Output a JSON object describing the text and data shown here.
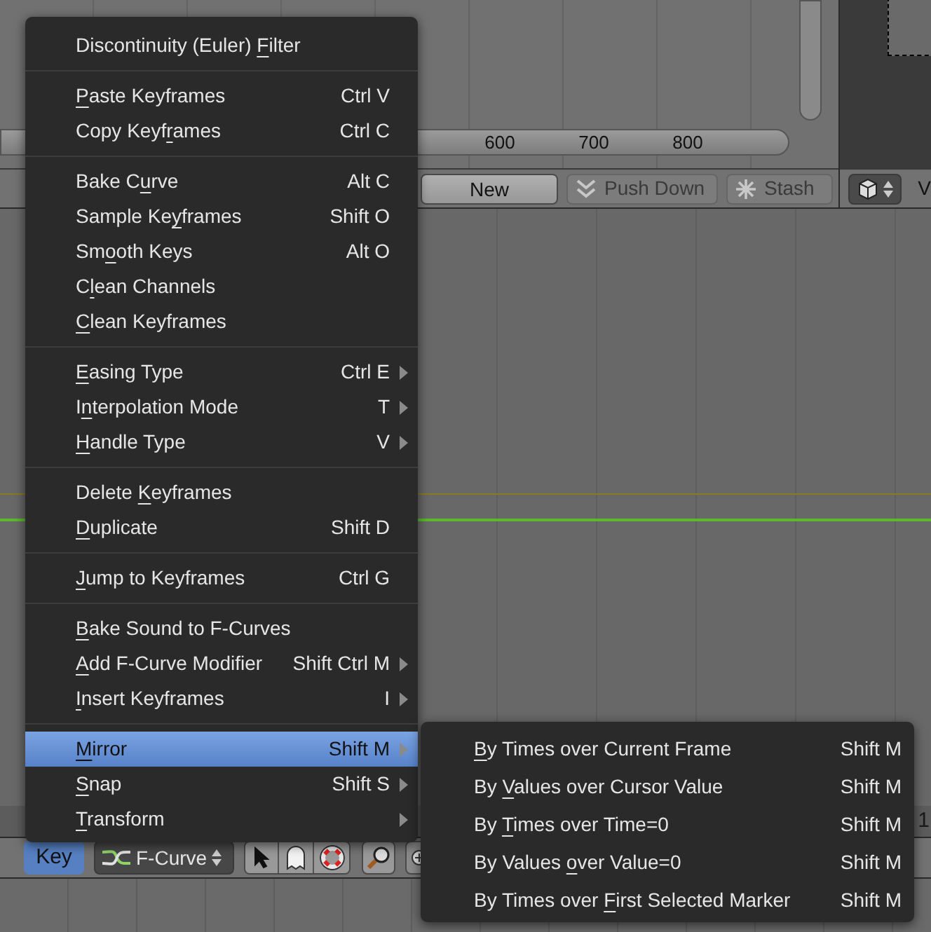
{
  "top_ruler": [
    "600",
    "700",
    "800"
  ],
  "top_header": {
    "buttons": [
      {
        "kind": "plain",
        "label": "New"
      },
      {
        "kind": "push",
        "label": "Push Down"
      },
      {
        "kind": "stash",
        "label": "Stash"
      }
    ]
  },
  "side_header": {
    "label": "V"
  },
  "bottom_ruler": [
    "1"
  ],
  "bottom_header": {
    "mode_button": {
      "label": "Key",
      "selected": true
    },
    "dropdown": {
      "label": "F-Curve"
    }
  },
  "menu": {
    "groups": [
      [
        {
          "label": {
            "before": "Discontinuity (Euler) ",
            "key": "F",
            "after": "ilter"
          },
          "selected": false,
          "submenu": false
        }
      ],
      [
        {
          "label": {
            "key": "P",
            "after": "aste Keyframes"
          },
          "shortcut": "Ctrl V",
          "selected": false,
          "submenu": false
        },
        {
          "label": {
            "before": "Copy Keyf",
            "key": "r",
            "after": "ames"
          },
          "shortcut": "Ctrl C",
          "selected": false,
          "submenu": false
        }
      ],
      [
        {
          "label": {
            "before": "Bake C",
            "key": "u",
            "after": "rve"
          },
          "shortcut": "Alt C",
          "selected": false,
          "submenu": false
        },
        {
          "label": {
            "before": "Sample Ke",
            "key": "y",
            "after": "frames"
          },
          "shortcut": "Shift O",
          "selected": false,
          "submenu": false
        },
        {
          "label": {
            "before": "Sm",
            "key": "o",
            "after": "oth Keys"
          },
          "shortcut": "Alt O",
          "selected": false,
          "submenu": false
        },
        {
          "label": {
            "before": "C",
            "key": "l",
            "after": "ean Channels"
          },
          "selected": false,
          "submenu": false
        },
        {
          "label": {
            "key": "C",
            "after": "lean Keyframes"
          },
          "selected": false,
          "submenu": false
        }
      ],
      [
        {
          "label": {
            "key": "E",
            "after": "asing Type"
          },
          "shortcut": "Ctrl E",
          "selected": false,
          "submenu": true
        },
        {
          "label": {
            "before": "I",
            "key": "n",
            "after": "terpolation Mode"
          },
          "shortcut": "T",
          "selected": false,
          "submenu": true
        },
        {
          "label": {
            "key": "H",
            "after": "andle Type"
          },
          "shortcut": "V",
          "selected": false,
          "submenu": true
        }
      ],
      [
        {
          "label": {
            "before": "Delete ",
            "key": "K",
            "after": "eyframes"
          },
          "selected": false,
          "submenu": false
        },
        {
          "label": {
            "key": "D",
            "after": "uplicate"
          },
          "shortcut": "Shift D",
          "selected": false,
          "submenu": false
        }
      ],
      [
        {
          "label": {
            "key": "J",
            "after": "ump to Keyframes"
          },
          "shortcut": "Ctrl G",
          "selected": false,
          "submenu": false
        }
      ],
      [
        {
          "label": {
            "key": "B",
            "after": "ake Sound to F-Curves"
          },
          "selected": false,
          "submenu": false
        },
        {
          "label": {
            "key": "A",
            "after": "dd F-Curve Modifier"
          },
          "shortcut": "Shift Ctrl M",
          "selected": false,
          "submenu": true
        },
        {
          "label": {
            "key": "I",
            "after": "nsert Keyframes"
          },
          "shortcut": "I",
          "selected": false,
          "submenu": true
        }
      ],
      [
        {
          "label": {
            "key": "M",
            "after": "irror"
          },
          "shortcut": "Shift M",
          "selected": true,
          "submenu": true
        },
        {
          "label": {
            "key": "S",
            "after": "nap"
          },
          "shortcut": "Shift S",
          "selected": false,
          "submenu": true
        },
        {
          "label": {
            "key": "T",
            "after": "ransform"
          },
          "selected": false,
          "submenu": true
        }
      ]
    ]
  },
  "submenu": {
    "items": [
      {
        "label": {
          "key": "B",
          "after": "y Times over Current Frame"
        },
        "shortcut": "Shift M"
      },
      {
        "label": {
          "before": "By ",
          "key": "V",
          "after": "alues over Cursor Value"
        },
        "shortcut": "Shift M"
      },
      {
        "label": {
          "before": "By ",
          "key": "T",
          "after": "imes over Time=0"
        },
        "shortcut": "Shift M"
      },
      {
        "label": {
          "before": "By Values ",
          "key": "o",
          "after": "ver Value=0"
        },
        "shortcut": "Shift M"
      },
      {
        "label": {
          "before": "By Times over ",
          "key": "F",
          "after": "irst Selected Marker"
        },
        "shortcut": "Shift M"
      }
    ]
  }
}
